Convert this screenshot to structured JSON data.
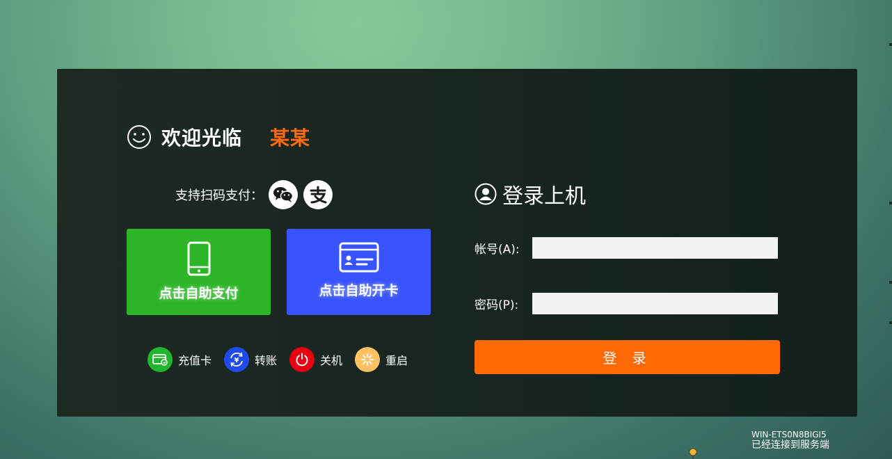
{
  "welcome": {
    "text": "欢迎光临",
    "name": "某某"
  },
  "scan_pay": {
    "label": "支持扫码支付："
  },
  "buttons": {
    "self_pay": "点击自助支付",
    "self_card": "点击自助开卡"
  },
  "actions": [
    {
      "label": "充值卡",
      "icon": "card-icon",
      "color": "#23b530"
    },
    {
      "label": "转账",
      "icon": "transfer-icon",
      "color": "#1f4bea"
    },
    {
      "label": "关机",
      "icon": "power-icon",
      "color": "#e60012"
    },
    {
      "label": "重启",
      "icon": "restart-icon",
      "color": "#ffc061"
    }
  ],
  "login": {
    "title": "登录上机",
    "account_label": "帐号(A):",
    "password_label": "密码(P):",
    "account_value": "",
    "password_value": "",
    "submit": "登 录"
  },
  "status": {
    "host": "WIN-ETS0N8BIGI5",
    "message": "已经连接到服务端"
  },
  "colors": {
    "accent": "#ff6a06",
    "pay_green": "#2cb527",
    "card_blue": "#3754fe"
  }
}
